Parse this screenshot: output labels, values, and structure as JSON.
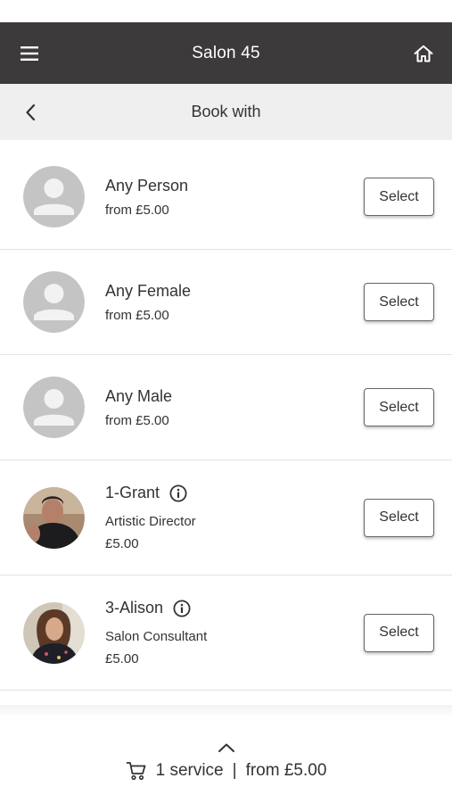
{
  "header": {
    "title": "Salon 45",
    "menu_icon": "hamburger-menu-icon",
    "home_icon": "home-icon",
    "background": "#3d3a3b"
  },
  "sub_header": {
    "title": "Book with",
    "back_icon": "chevron-left-icon"
  },
  "staff": [
    {
      "name": "Any Person",
      "price": "from £5.00",
      "avatar": "generic-person-avatar",
      "select_label": "Select"
    },
    {
      "name": "Any Female",
      "price": "from £5.00",
      "avatar": "generic-person-avatar",
      "select_label": "Select"
    },
    {
      "name": "Any Male",
      "price": "from £5.00",
      "avatar": "generic-person-avatar",
      "select_label": "Select"
    },
    {
      "name": "1-Grant",
      "role": "Artistic Director",
      "price": "£5.00",
      "avatar": "photo-avatar",
      "info_icon": "info-icon",
      "select_label": "Select"
    },
    {
      "name": "3-Alison",
      "role": "Salon Consultant",
      "price": "£5.00",
      "avatar": "photo-avatar",
      "info_icon": "info-icon",
      "select_label": "Select"
    }
  ],
  "cart": {
    "expand_icon": "chevron-up-icon",
    "cart_icon": "shopping-cart-icon",
    "count_text": "1 service",
    "separator": "|",
    "total_text": "from £5.00"
  }
}
